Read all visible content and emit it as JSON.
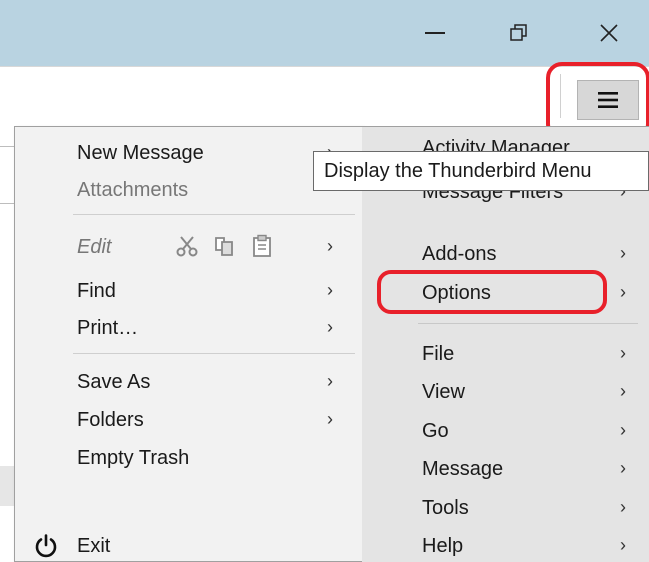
{
  "window": {
    "minimize_icon": "minimize-icon",
    "restore_icon": "restore-icon",
    "close_icon": "close-icon"
  },
  "toolbar": {
    "menu_icon": "hamburger-menu-icon"
  },
  "tooltip": {
    "text": "Display the Thunderbird Menu"
  },
  "left_menu": {
    "new_message": "New Message",
    "attachments": "Attachments",
    "edit": "Edit",
    "find": "Find",
    "print": "Print…",
    "save_as": "Save As",
    "folders": "Folders",
    "empty_trash": "Empty Trash",
    "exit": "Exit",
    "arrow": "›"
  },
  "right_menu": {
    "activity_manager": "Activity Manager",
    "message_filters": "Message Filters",
    "addons": "Add-ons",
    "options": "Options",
    "file": "File",
    "view": "View",
    "go": "Go",
    "message": "Message",
    "tools": "Tools",
    "help": "Help",
    "arrow": "›"
  },
  "colors": {
    "titlebar": "#b9d3e1",
    "annotation_red": "#e8202a",
    "menu_bg": "#f2f2f2",
    "submenu_bg": "#e4e4e4"
  }
}
